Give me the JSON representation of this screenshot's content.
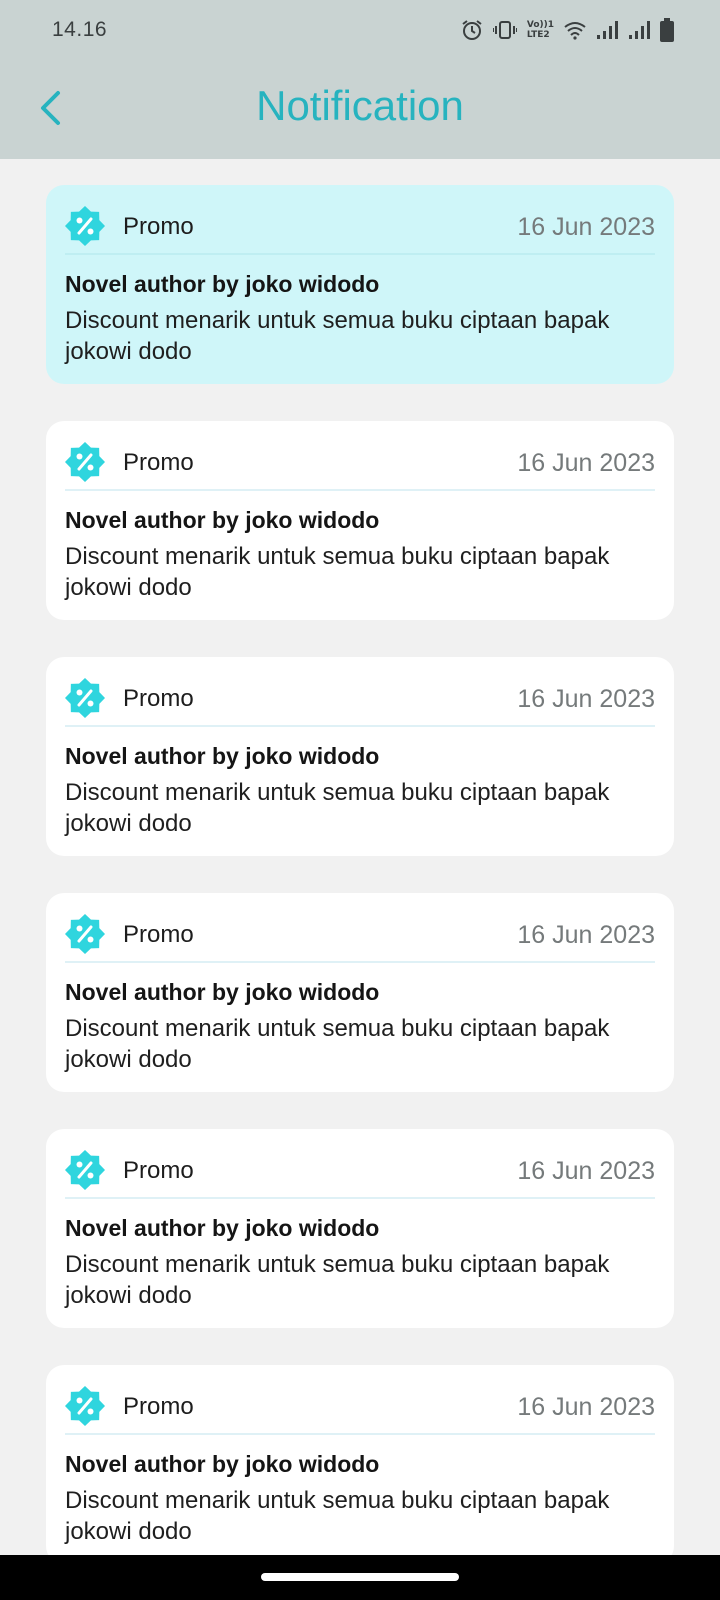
{
  "status_bar": {
    "time": "14.16",
    "icons": [
      "alarm-icon",
      "vibrate-icon",
      "volte-icon",
      "wifi-icon",
      "signal-icon",
      "signal-icon",
      "battery-icon"
    ],
    "volte_line1": "Vo))1",
    "volte_line2": "LTE2"
  },
  "header": {
    "title": "Notification",
    "back_icon": "chevron-left-icon"
  },
  "colors": {
    "accent": "#27b3bf",
    "icon": "#2fd5de",
    "unread_bg": "#cff6f9",
    "card_bg": "#ffffff",
    "page_bg": "#f1f1f1"
  },
  "notifications": [
    {
      "type": "Promo",
      "date": "16 Jun 2023",
      "title": "Novel author by joko widodo",
      "body": "Discount menarik untuk semua buku ciptaan bapak jokowi dodo",
      "icon": "discount-badge-icon",
      "unread": true
    },
    {
      "type": "Promo",
      "date": "16 Jun 2023",
      "title": "Novel author by joko widodo",
      "body": "Discount menarik untuk semua buku ciptaan bapak jokowi dodo",
      "icon": "discount-badge-icon",
      "unread": false
    },
    {
      "type": "Promo",
      "date": "16 Jun 2023",
      "title": "Novel author by joko widodo",
      "body": "Discount menarik untuk semua buku ciptaan bapak jokowi dodo",
      "icon": "discount-badge-icon",
      "unread": false
    },
    {
      "type": "Promo",
      "date": "16 Jun 2023",
      "title": "Novel author by joko widodo",
      "body": "Discount menarik untuk semua buku ciptaan bapak jokowi dodo",
      "icon": "discount-badge-icon",
      "unread": false
    },
    {
      "type": "Promo",
      "date": "16 Jun 2023",
      "title": "Novel author by joko widodo",
      "body": "Discount menarik untuk semua buku ciptaan bapak jokowi dodo",
      "icon": "discount-badge-icon",
      "unread": false
    },
    {
      "type": "Promo",
      "date": "16 Jun 2023",
      "title": "Novel author by joko widodo",
      "body": "Discount menarik untuk semua buku ciptaan bapak jokowi dodo",
      "icon": "discount-badge-icon",
      "unread": false
    }
  ]
}
